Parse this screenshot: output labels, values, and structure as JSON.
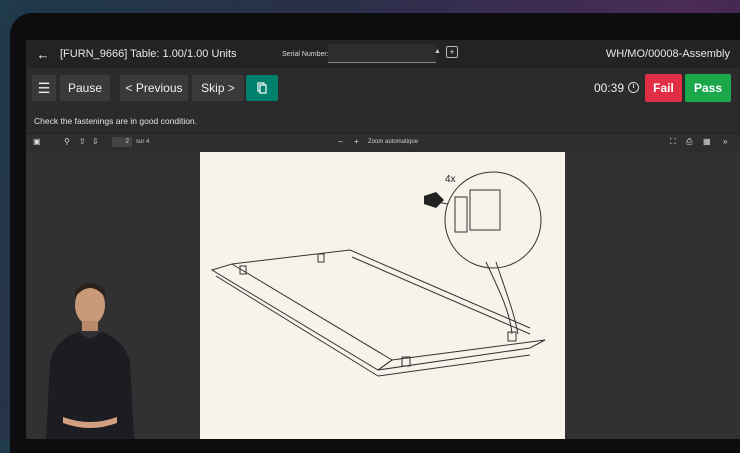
{
  "header": {
    "title": "[FURN_9666] Table: 1.00/1.00 Units",
    "serial_label": "Serial Number:",
    "serial_value": "",
    "work_order": "WH/MO/00008-Assembly"
  },
  "toolbar": {
    "pause": "Pause",
    "previous": "< Previous",
    "skip": "Skip >",
    "timer": "00:39",
    "fail": "Fail",
    "pass": "Pass"
  },
  "instruction": "Check the fastenings are in good condition.",
  "pdf": {
    "page": "2",
    "page_of": "sur 4",
    "zoom": "Zoom automatique",
    "diagram_label": "4x"
  },
  "colors": {
    "accent_teal": "#00806d",
    "fail_red": "#e02f45",
    "pass_green": "#1ba84b"
  }
}
